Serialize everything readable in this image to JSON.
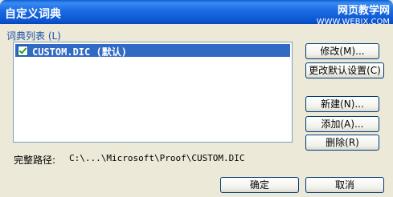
{
  "window": {
    "title": "自定义词典"
  },
  "watermark": {
    "line1": "网页教学网",
    "line2": "WWW.WEBJX.COM"
  },
  "dictionary_list": {
    "label": "词典列表 (L)",
    "items": [
      {
        "name": "CUSTOM.DIC (默认)",
        "checked": true,
        "selected": true
      }
    ]
  },
  "buttons": {
    "modify": "修改(M)...",
    "change_default": "更改默认设置(C)",
    "new": "新建(N)...",
    "add": "添加(A)...",
    "delete": "删除(R)",
    "ok": "确定",
    "cancel": "取消"
  },
  "path": {
    "label": "完整路径:",
    "value": "C:\\...\\Microsoft\\Proof\\CUSTOM.DIC"
  },
  "colors": {
    "titlebar": "#0a55d0",
    "selection": "#316ac5",
    "dialog_bg": "#ece9d8"
  }
}
